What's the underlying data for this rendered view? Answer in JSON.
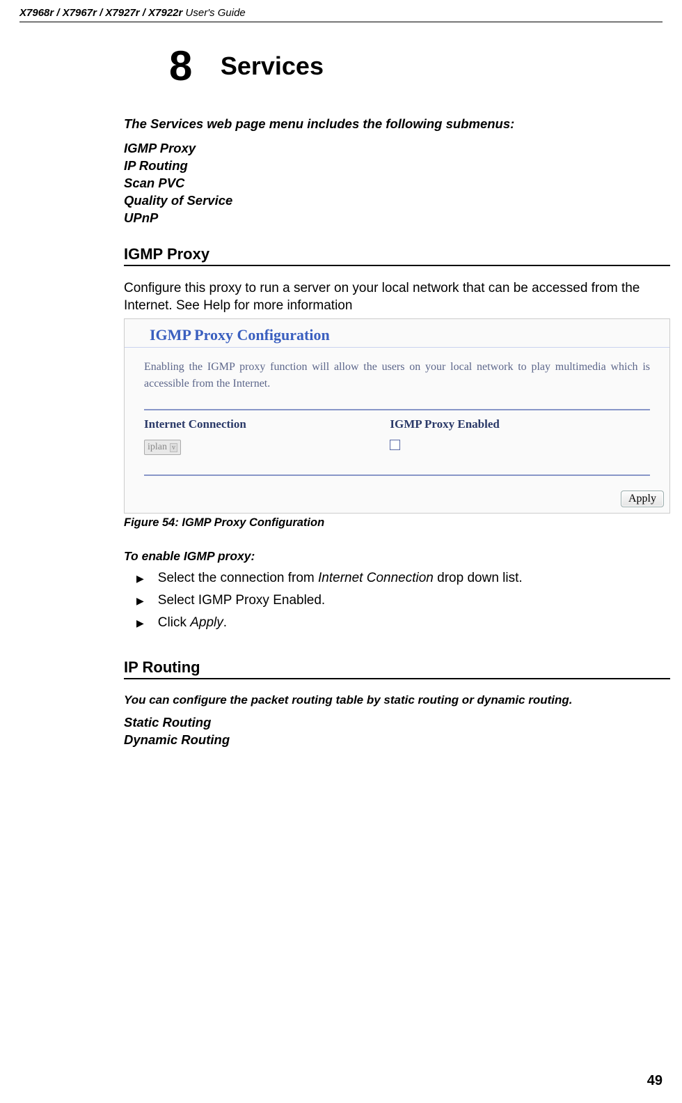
{
  "header": {
    "models": "X7968r / X7967r / X7927r / X7922r",
    "guide": " User's Guide"
  },
  "chapter": {
    "number": "8",
    "title": "Services"
  },
  "intro": "The Services web page menu includes the following submenus:",
  "submenus": [
    "IGMP Proxy",
    "IP Routing",
    "Scan PVC",
    "Quality of Service",
    "UPnP"
  ],
  "section1": {
    "heading": "IGMP Proxy",
    "body": "Configure this proxy to run a server on your local network that can be accessed from the Internet. See Help for more information",
    "screenshot": {
      "title": "IGMP Proxy Configuration",
      "desc": "Enabling the IGMP proxy function will allow the users on your local network to play multimedia which is accessible from the Internet.",
      "col1_label": "Internet Connection",
      "col2_label": "IGMP Proxy Enabled",
      "select_value": "iplan",
      "apply_label": "Apply"
    },
    "figure_caption": "Figure 54: IGMP Proxy Configuration",
    "steps_heading": "To enable IGMP proxy:",
    "steps": [
      {
        "pre": "Select the connection from ",
        "em": "Internet Connection",
        "post": " drop down list."
      },
      {
        "pre": "Select IGMP Proxy Enabled.",
        "em": "",
        "post": ""
      },
      {
        "pre": "Click ",
        "em": "Apply",
        "post": "."
      }
    ]
  },
  "section2": {
    "heading": "IP Routing",
    "intro": "You can configure the packet routing table by static routing or dynamic routing.",
    "items": [
      "Static Routing",
      "Dynamic Routing"
    ]
  },
  "page_number": "49"
}
